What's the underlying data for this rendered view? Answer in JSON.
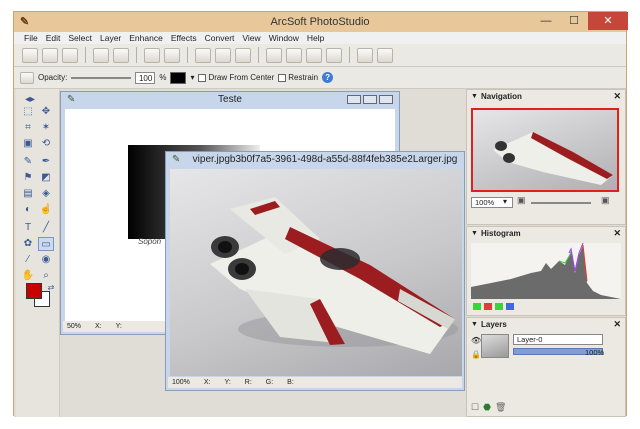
{
  "app": {
    "title": "ArcSoft PhotoStudio",
    "minimize": "—",
    "maximize": "☐",
    "close": "✕"
  },
  "menu": [
    "File",
    "Edit",
    "Select",
    "Layer",
    "Enhance",
    "Effects",
    "Convert",
    "View",
    "Window",
    "Help"
  ],
  "options": {
    "opacity_label": "Opacity:",
    "opacity_value": "100",
    "percent": "%",
    "draw_from_center": "Draw From Center",
    "restrain": "Restrain",
    "help": "?"
  },
  "doc1": {
    "title": "Teste",
    "zoom": "50%",
    "x": "X:",
    "y": "Y:",
    "caption": "Sopon"
  },
  "doc2": {
    "title": "viper.jpgb3b0f7a5-3961-498d-a55d-88f4feb385e2Larger.jpg",
    "zoom": "100%",
    "x": "X:",
    "y": "Y:",
    "r": "R:",
    "g": "G:",
    "b": "B:"
  },
  "navigation": {
    "title": "Navigation",
    "zoom": "100%"
  },
  "histogram": {
    "title": "Histogram"
  },
  "layers": {
    "title": "Layers",
    "layer_name": "Layer-0",
    "opacity": "100%"
  },
  "colors": {
    "title_bg": "#e8c89a",
    "accent": "#3d7bd6",
    "foreground": "#c80000",
    "nav_frame": "#e0201c"
  }
}
